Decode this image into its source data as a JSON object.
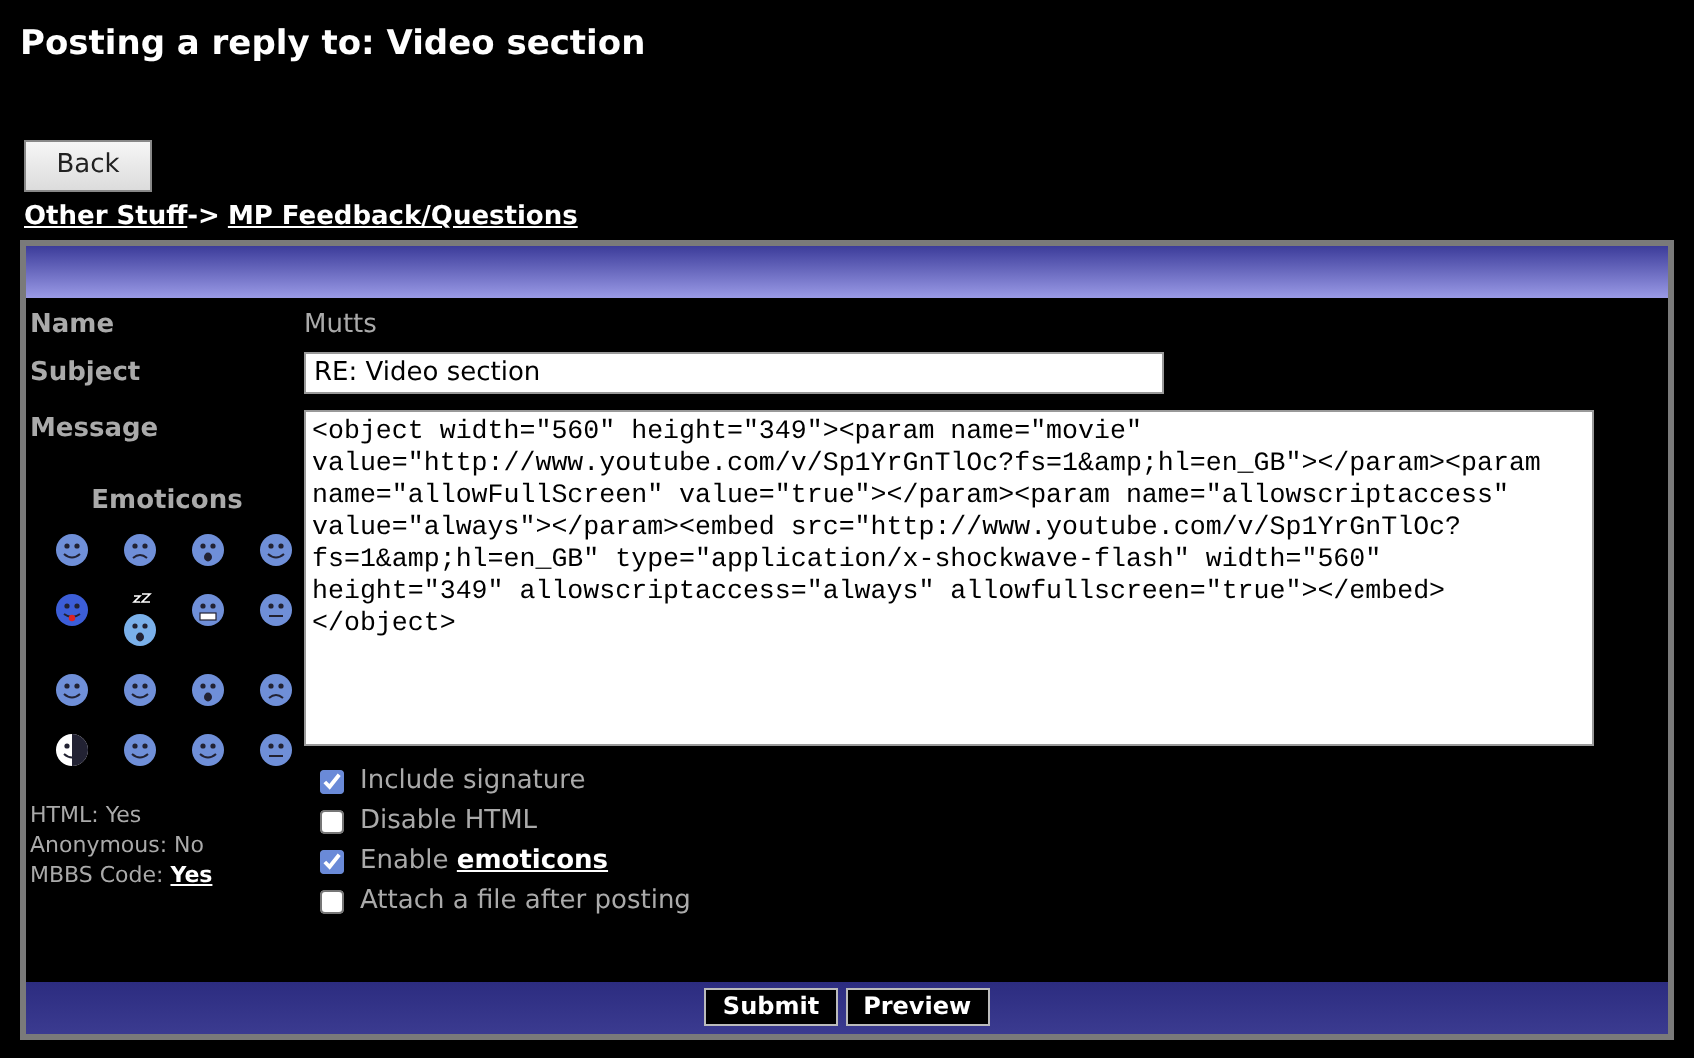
{
  "page_title": "Posting a reply to: Video section",
  "back_button": "Back",
  "breadcrumb": [
    {
      "label": "Other Stuff",
      "separator": "->"
    },
    {
      "label": "MP Feedback/Questions"
    }
  ],
  "form": {
    "name_label": "Name",
    "name_value": "Mutts",
    "subject_label": "Subject",
    "subject_value": "RE: Video section",
    "message_label": "Message",
    "message_value": "<object width=\"560\" height=\"349\"><param name=\"movie\" value=\"http://www.youtube.com/v/Sp1YrGnTlOc?fs=1&amp;hl=en_GB\"></param><param name=\"allowFullScreen\" value=\"true\"></param><param name=\"allowscriptaccess\" value=\"always\"></param><embed src=\"http://www.youtube.com/v/Sp1YrGnTlOc?fs=1&amp;hl=en_GB\" type=\"application/x-shockwave-flash\" width=\"560\" height=\"349\" allowscriptaccess=\"always\" allowfullscreen=\"true\"></embed></object>",
    "emoticons_heading": "Emoticons"
  },
  "info": [
    {
      "label": "HTML: Yes"
    },
    {
      "label": "Anonymous: No"
    },
    {
      "label": "MBBS Code:",
      "link": "Yes"
    }
  ],
  "options": [
    {
      "label": "Include signature",
      "checked": true
    },
    {
      "label": "Disable HTML",
      "checked": false
    },
    {
      "label": "Enable",
      "link": "emoticons",
      "checked": true
    },
    {
      "label": "Attach a file after posting",
      "checked": false
    }
  ],
  "buttons": [
    "Submit",
    "Preview"
  ]
}
